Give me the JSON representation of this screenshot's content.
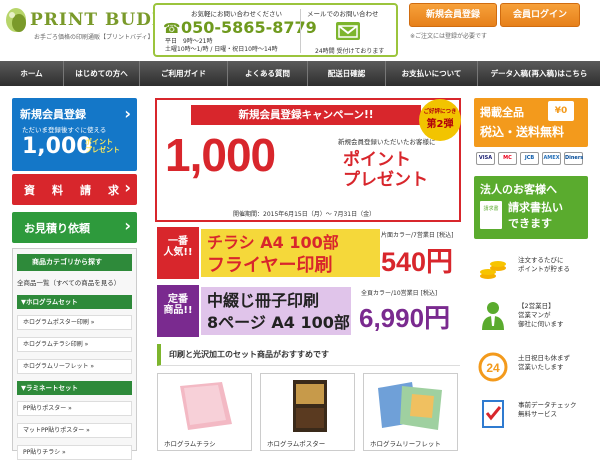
{
  "header": {
    "logo_name": "PRINT BUDDY",
    "logo_sub": "お手ごろ価格の印刷通販【プリントバディ】",
    "contact_phone_label": "お気軽にお問い合わせください",
    "phone": "050-5865-8779",
    "hours": "平日　9時〜21時\n土曜10時〜1/時 / 日曜・祝日10時〜14時",
    "contact_mail_label": "メールでのお問い合わせ",
    "mail_hours": "24時間 受付けております",
    "register_button": "新規会員登録",
    "login_button": "会員ログイン",
    "cookie_note": "※ご注文には登録が必要です"
  },
  "nav": {
    "items": [
      {
        "label": "ホーム",
        "w": 0
      },
      {
        "label": "はじめての方へ",
        "w": 0
      },
      {
        "label": "ご利用ガイド",
        "w": 0
      },
      {
        "label": "よくある質問",
        "w": 0
      },
      {
        "label": "配送日確認",
        "w": 0
      },
      {
        "label": "お支払いについて",
        "w": 0
      },
      {
        "label": "データ入稿(再入稿)はこちら",
        "w": 0
      }
    ]
  },
  "left": {
    "register_title": "新規会員登録",
    "register_line": "ただいま登録後すぐに使える",
    "register_points": "1,000",
    "register_points_label": "ポイント\nプレゼント",
    "catalog_button": "資　料　請　求",
    "estimate_button": "お見積り依頼",
    "category_title": "商品カテゴリから探す",
    "category_all": "全商品一覧（すべての商品を見る）",
    "sections": [
      {
        "title": "▼ホログラムセット",
        "items": [
          "ホログラムポスター印刷 »",
          "ホログラムチラシ印刷 »",
          "ホログラムリーフレット »"
        ]
      },
      {
        "title": "▼ラミネートセット",
        "items": [
          "PP貼りポスター »",
          "マットPP貼りポスター »",
          "PP貼りチラシ »"
        ]
      }
    ]
  },
  "campaign": {
    "banner": "新規会員登録キャンペーン!!",
    "badge_top": "ご好評につき",
    "badge_main": "第2弾",
    "note": "新規会員登録いただいたお客様に",
    "amount": "1,000",
    "points": "ポイント\nプレゼント",
    "period": "開催期間：2015年6月15日（月）〜 7月31日（金）"
  },
  "promos": [
    {
      "tag": "一番\n人気!!",
      "line1": "チラシ A4 100部",
      "line2": "フライヤー印刷",
      "caption": "片面カラー/7営業日 [税込]",
      "price": "540円"
    },
    {
      "tag": "定番\n商品!!",
      "line1": "中綴じ冊子印刷",
      "line2": "8ページ A4 100部",
      "caption": "全頁カラー/10営業日 [税込]",
      "price": "6,990円"
    }
  ],
  "set_heading": "印刷と光沢加工のセット商品がおすすめです",
  "products": [
    {
      "caption": "ホログラムチラシ"
    },
    {
      "caption": "ホログラムポスター"
    },
    {
      "caption": "ホログラムリーフレット"
    }
  ],
  "right": {
    "free_title": "掲載全品",
    "free_sub": "税込・送料無料",
    "yen_icon": "¥0",
    "cards": [
      "VISA",
      "MC",
      "JCB",
      "AMEX",
      "Diners"
    ],
    "corp_title": "法人のお客様へ",
    "corp_doc": "請求書",
    "corp_sub": "請求書払い\nできます",
    "features": [
      {
        "icon": "coins-icon",
        "text": "注文するたびに\nポイントが貯まる"
      },
      {
        "icon": "staff-icon",
        "text": "【2営業日】\n営業マンが\n御社に伺います"
      },
      {
        "icon": "24-hours-icon",
        "text": "土日祝日も休まず\n営業いたします"
      },
      {
        "icon": "checklist-icon",
        "text": "事前データチェック\n無料サービス"
      }
    ]
  },
  "colors": {
    "brand_green": "#7db52d",
    "accent_orange": "#f39a1c",
    "accent_red": "#d8262c",
    "blue": "#1477c8"
  }
}
